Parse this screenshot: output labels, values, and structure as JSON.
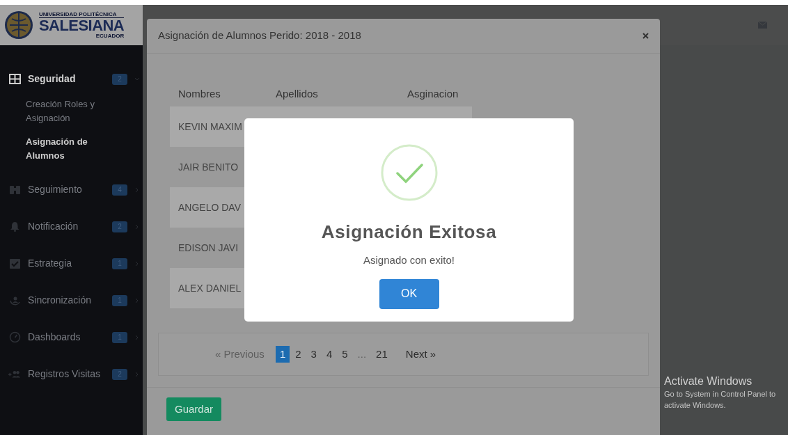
{
  "logo": {
    "top_line": "UNIVERSIDAD POLITÉCNICA",
    "name": "SALESIANA",
    "sub": "ECUADOR"
  },
  "sidebar": {
    "items": [
      {
        "label": "Seguridad",
        "badge": "2",
        "expanded": true,
        "children": [
          {
            "label": "Creación Roles y Asignación",
            "selected": false
          },
          {
            "label": "Asignación de Alumnos",
            "selected": true
          }
        ]
      },
      {
        "label": "Seguimiento",
        "badge": "4",
        "expanded": false
      },
      {
        "label": "Notificación",
        "badge": "2",
        "expanded": false
      },
      {
        "label": "Estrategia",
        "badge": "1",
        "expanded": false
      },
      {
        "label": "Sincronización",
        "badge": "1",
        "expanded": false
      },
      {
        "label": "Dashboards",
        "badge": "1",
        "expanded": false
      },
      {
        "label": "Registros Visitas",
        "badge": "2",
        "expanded": false
      }
    ]
  },
  "modal": {
    "title": "Asignación de Alumnos Perido: 2018 - 2018",
    "table": {
      "columns": [
        "Nombres",
        "Apellidos",
        "Asginacion"
      ],
      "rows": [
        {
          "cells": [
            "KEVIN MAXIM"
          ]
        },
        {
          "cells": [
            "JAIR BENITO"
          ]
        },
        {
          "cells": [
            "ANGELO DAV"
          ]
        },
        {
          "cells": [
            "EDISON JAVI"
          ]
        },
        {
          "cells": [
            "ALEX DANIEL"
          ]
        }
      ]
    },
    "pagination": [
      {
        "label": "« Previous",
        "kind": "prev",
        "disabled": true,
        "selected": false
      },
      {
        "label": "1",
        "kind": "page",
        "disabled": false,
        "selected": true
      },
      {
        "label": "2",
        "kind": "page",
        "disabled": false,
        "selected": false
      },
      {
        "label": "3",
        "kind": "page",
        "disabled": false,
        "selected": false
      },
      {
        "label": "4",
        "kind": "page",
        "disabled": false,
        "selected": false
      },
      {
        "label": "5",
        "kind": "page",
        "disabled": false,
        "selected": false
      },
      {
        "label": "...",
        "kind": "ellipsis",
        "disabled": true,
        "selected": false
      },
      {
        "label": "21",
        "kind": "page",
        "disabled": false,
        "selected": false
      },
      {
        "label": "Next »",
        "kind": "next",
        "disabled": false,
        "selected": false
      }
    ],
    "save_button": "Guardar"
  },
  "alert": {
    "title": "Asignación Exitosa",
    "message": "Asignado con exito!",
    "button": "OK"
  },
  "os_notice": {
    "title": "Activate Windows",
    "message": "Go to System in Control Panel to activate Windows."
  }
}
